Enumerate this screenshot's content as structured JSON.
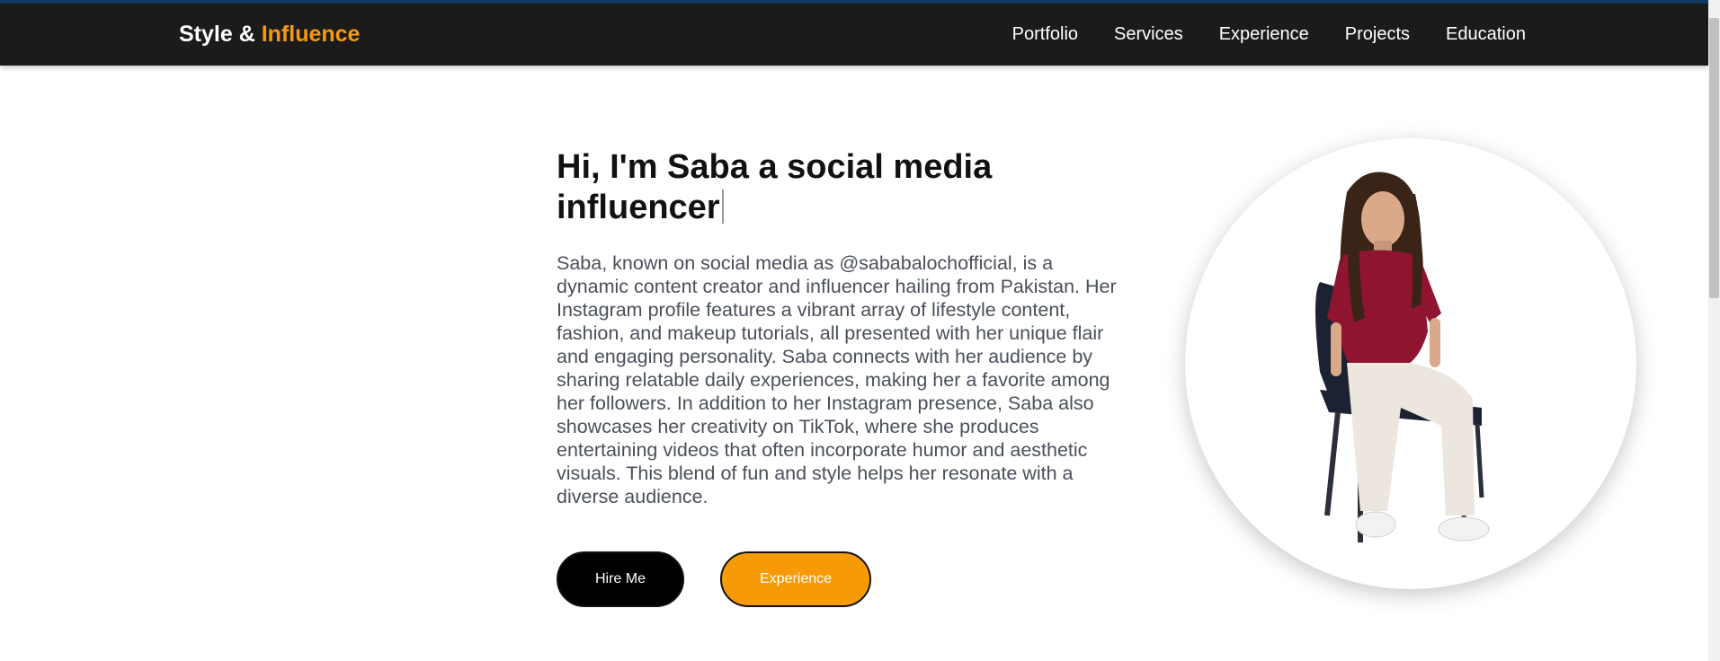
{
  "header": {
    "brand_main": "Style & ",
    "brand_accent": "Influence",
    "nav": [
      "Portfolio",
      "Services",
      "Experience",
      "Projects",
      "Education"
    ]
  },
  "hero": {
    "title": "Hi, I'm Saba a social media influencer",
    "description": "Saba, known on social media as @sababalochofficial, is a dynamic content creator and influencer hailing from Pakistan. Her Instagram profile features a vibrant array of lifestyle content, fashion, and makeup tutorials, all presented with her unique flair and engaging personality. Saba connects with her audience by sharing relatable daily experiences, making her a favorite among her followers. In addition to her Instagram presence, Saba also showcases her creativity on TikTok, where she produces entertaining videos that often incorporate humor and aesthetic visuals. This blend of fun and style helps her resonate with a diverse audience.",
    "buttons": {
      "hire": "Hire Me",
      "experience": "Experience"
    }
  },
  "colors": {
    "navbar": "#1b1b1b",
    "accent": "#f59a0c",
    "top_accent": "#143c63"
  },
  "icons": {
    "portrait": "person-seated-photo"
  }
}
